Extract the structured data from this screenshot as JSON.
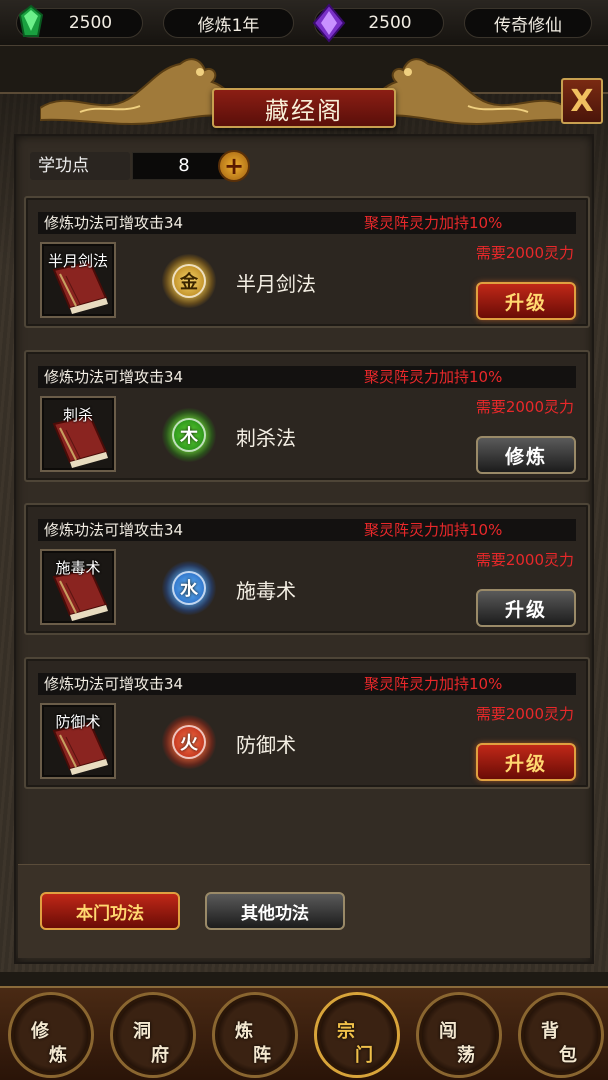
{
  "topbar": {
    "green_gem_count": "2500",
    "cultivation_time": "修炼1年",
    "purple_gem_count": "2500",
    "game_title": "传奇修仙",
    "green_gem_icon": "green-gem-icon",
    "purple_gem_icon": "purple-gem-icon"
  },
  "panel": {
    "title": "藏经阁",
    "close_label": "X",
    "skill_points_label": "学功点",
    "skill_points_value": "8",
    "add_label": "+"
  },
  "skills": [
    {
      "desc": "修炼功法可增攻击34",
      "bonus": "聚灵阵灵力加持10%",
      "cost": "需要2000灵力",
      "book_label": "半月剑法",
      "element": "金",
      "element_color": "#d4a020",
      "name": "半月剑法",
      "action": "升级",
      "action_style": "red"
    },
    {
      "desc": "修炼功法可增攻击34",
      "bonus": "聚灵阵灵力加持10%",
      "cost": "需要2000灵力",
      "book_label": "刺杀",
      "element": "木",
      "element_color": "#30b020",
      "name": "刺杀法",
      "action": "修炼",
      "action_style": "gray"
    },
    {
      "desc": "修炼功法可增攻击34",
      "bonus": "聚灵阵灵力加持10%",
      "cost": "需要2000灵力",
      "book_label": "施毒术",
      "element": "水",
      "element_color": "#2a7ae0",
      "name": "施毒术",
      "action": "升级",
      "action_style": "gray"
    },
    {
      "desc": "修炼功法可增攻击34",
      "bonus": "聚灵阵灵力加持10%",
      "cost": "需要2000灵力",
      "book_label": "防御术",
      "element": "火",
      "element_color": "#d03018",
      "name": "防御术",
      "action": "升级",
      "action_style": "red"
    }
  ],
  "tabs": {
    "own_sect": "本门功法",
    "other": "其他功法"
  },
  "nav": [
    {
      "c1": "修",
      "c2": "炼"
    },
    {
      "c1": "洞",
      "c2": "府"
    },
    {
      "c1": "炼",
      "c2": "阵"
    },
    {
      "c1": "宗",
      "c2": "门"
    },
    {
      "c1": "闯",
      "c2": "荡"
    },
    {
      "c1": "背",
      "c2": "包"
    }
  ],
  "colors": {
    "accent_red": "#e8282a",
    "gold": "#ffd870"
  }
}
